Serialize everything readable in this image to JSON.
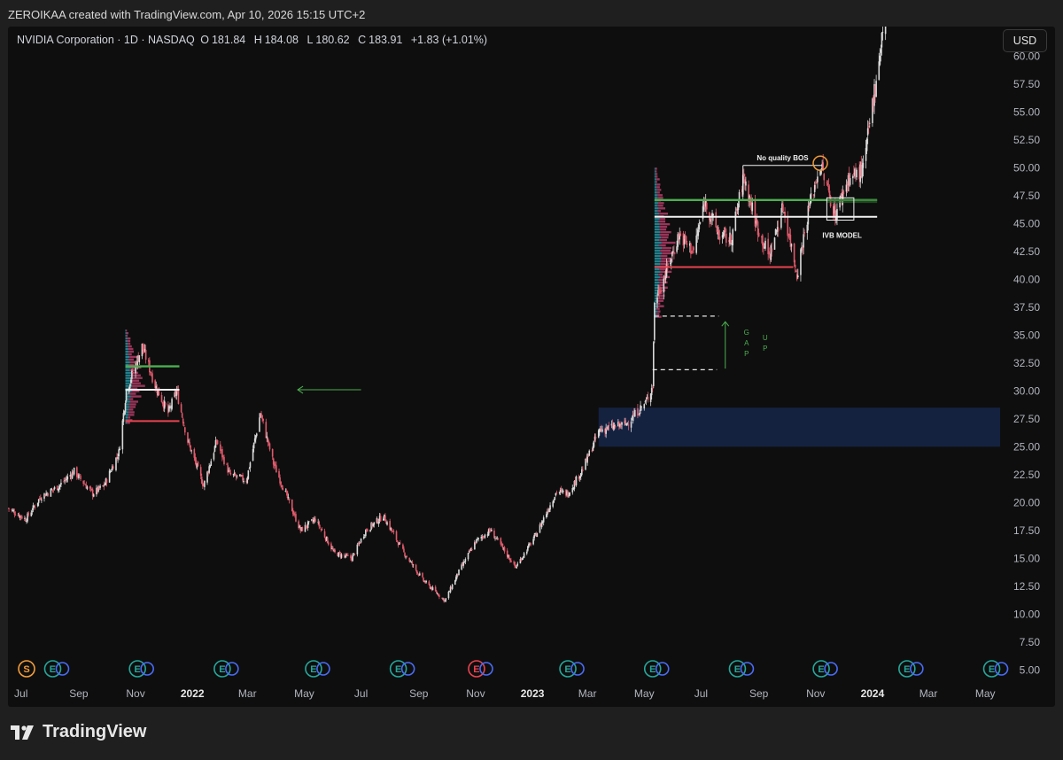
{
  "attribution": "ZEROIKAA created with TradingView.com, Apr 10, 2026 15:15 UTC+2",
  "header": {
    "symbol": "NVIDIA Corporation · 1D · NASDAQ",
    "open_label": "O",
    "open": "181.84",
    "high_label": "H",
    "high": "184.08",
    "low_label": "L",
    "low": "180.62",
    "close_label": "C",
    "close": "183.91",
    "change": "+1.83 (+1.01%)"
  },
  "currency_button": "USD",
  "footer": {
    "brand": "TradingView"
  },
  "colors": {
    "up": "#d9d9d9",
    "down": "#e0596b",
    "green_level": "#4caf50",
    "red_level": "#e8434f",
    "fvg_zone": "#142240",
    "arrow": "#4caf50",
    "highlight_circle": "#f39c3a",
    "volume_profile_up": "#2aa7b8",
    "volume_profile_down": "#d6467a"
  },
  "chart_data": {
    "type": "candlestick",
    "instrument": "NVDA",
    "timeframe": "1D",
    "y_axis": {
      "ylim": [
        3.0,
        63.0
      ],
      "ticks": [
        5.0,
        7.5,
        10.0,
        12.5,
        15.0,
        17.5,
        20.0,
        22.5,
        25.0,
        27.5,
        30.0,
        32.5,
        35.0,
        37.5,
        40.0,
        42.5,
        45.0,
        47.5,
        50.0,
        52.5,
        55.0,
        57.5,
        60.0
      ]
    },
    "x_axis": {
      "range": [
        "2021-07-01",
        "2024-05-31"
      ],
      "ticks": [
        {
          "label": "Jul",
          "date": "2021-07-15"
        },
        {
          "label": "Sep",
          "date": "2021-09-15"
        },
        {
          "label": "Nov",
          "date": "2021-11-15"
        },
        {
          "label": "2022",
          "date": "2022-01-15",
          "bold": true
        },
        {
          "label": "Mar",
          "date": "2022-03-15"
        },
        {
          "label": "May",
          "date": "2022-05-15"
        },
        {
          "label": "Jul",
          "date": "2022-07-15"
        },
        {
          "label": "Sep",
          "date": "2022-09-15"
        },
        {
          "label": "Nov",
          "date": "2022-11-15"
        },
        {
          "label": "2023",
          "date": "2023-01-15",
          "bold": true
        },
        {
          "label": "Mar",
          "date": "2023-03-15"
        },
        {
          "label": "May",
          "date": "2023-05-15"
        },
        {
          "label": "Jul",
          "date": "2023-07-15"
        },
        {
          "label": "Sep",
          "date": "2023-09-15"
        },
        {
          "label": "Nov",
          "date": "2023-11-15"
        },
        {
          "label": "2024",
          "date": "2024-01-15",
          "bold": true
        },
        {
          "label": "Mar",
          "date": "2024-03-15"
        },
        {
          "label": "May",
          "date": "2024-05-15"
        }
      ]
    },
    "price_path": [
      [
        "2021-07-01",
        19.5
      ],
      [
        "2021-07-20",
        18.5
      ],
      [
        "2021-08-05",
        20.5
      ],
      [
        "2021-08-25",
        21.5
      ],
      [
        "2021-09-10",
        22.8
      ],
      [
        "2021-09-30",
        20.8
      ],
      [
        "2021-10-12",
        21.5
      ],
      [
        "2021-10-28",
        24.5
      ],
      [
        "2021-11-05",
        30.0
      ],
      [
        "2021-11-22",
        34.0
      ],
      [
        "2021-12-06",
        30.5
      ],
      [
        "2021-12-20",
        28.0
      ],
      [
        "2021-12-29",
        30.0
      ],
      [
        "2022-01-10",
        25.5
      ],
      [
        "2022-01-27",
        21.5
      ],
      [
        "2022-02-10",
        25.5
      ],
      [
        "2022-02-24",
        22.5
      ],
      [
        "2022-03-14",
        22.0
      ],
      [
        "2022-03-29",
        28.0
      ],
      [
        "2022-04-12",
        23.5
      ],
      [
        "2022-05-11",
        17.5
      ],
      [
        "2022-05-27",
        18.5
      ],
      [
        "2022-06-16",
        15.5
      ],
      [
        "2022-07-05",
        15.0
      ],
      [
        "2022-07-20",
        17.5
      ],
      [
        "2022-08-08",
        18.8
      ],
      [
        "2022-08-30",
        15.5
      ],
      [
        "2022-09-20",
        13.0
      ],
      [
        "2022-10-13",
        11.2
      ],
      [
        "2022-10-28",
        13.8
      ],
      [
        "2022-11-15",
        16.5
      ],
      [
        "2022-12-01",
        17.5
      ],
      [
        "2022-12-28",
        14.2
      ],
      [
        "2023-01-18",
        17.0
      ],
      [
        "2023-02-10",
        21.0
      ],
      [
        "2023-02-22",
        20.8
      ],
      [
        "2023-03-10",
        23.0
      ],
      [
        "2023-03-28",
        26.5
      ],
      [
        "2023-04-25",
        27.0
      ],
      [
        "2023-05-17",
        29.0
      ],
      [
        "2023-05-24",
        30.5
      ],
      [
        "2023-05-26",
        38.0
      ],
      [
        "2023-06-07",
        40.5
      ],
      [
        "2023-06-21",
        44.0
      ],
      [
        "2023-07-07",
        42.5
      ],
      [
        "2023-07-19",
        47.0
      ],
      [
        "2023-08-03",
        44.0
      ],
      [
        "2023-08-16",
        43.5
      ],
      [
        "2023-08-30",
        49.2
      ],
      [
        "2023-09-12",
        45.0
      ],
      [
        "2023-09-26",
        42.0
      ],
      [
        "2023-10-11",
        46.5
      ],
      [
        "2023-10-26",
        40.5
      ],
      [
        "2023-11-08",
        46.5
      ],
      [
        "2023-11-20",
        50.3
      ],
      [
        "2023-12-06",
        45.8
      ],
      [
        "2023-12-20",
        49.0
      ],
      [
        "2024-01-05",
        49.8
      ],
      [
        "2024-01-24",
        61.0
      ],
      [
        "2024-02-05",
        70.0
      ]
    ],
    "volume_profiles": [
      {
        "date": "2021-11-04",
        "price_low": 27.0,
        "price_high": 35.5,
        "width_days": 28
      },
      {
        "date": "2023-05-26",
        "price_low": 36.5,
        "price_high": 50.0,
        "width_days": 30
      }
    ],
    "levels": [
      {
        "name": "green-level-1",
        "price": 32.2,
        "start": "2021-11-04",
        "end": "2022-01-01",
        "color": "green"
      },
      {
        "name": "white-level-1",
        "price": 30.1,
        "start": "2021-11-04",
        "end": "2022-01-01",
        "color": "white"
      },
      {
        "name": "red-level-1",
        "price": 27.3,
        "start": "2021-11-04",
        "end": "2022-01-01",
        "color": "red"
      },
      {
        "name": "green-level-2",
        "price": 47.1,
        "start": "2023-05-26",
        "end": "2024-01-20",
        "color": "green"
      },
      {
        "name": "white-level-2",
        "price": 45.6,
        "start": "2023-05-26",
        "end": "2024-01-20",
        "color": "white"
      },
      {
        "name": "red-level-2",
        "price": 41.1,
        "start": "2023-05-26",
        "end": "2023-10-22",
        "color": "red"
      }
    ],
    "gap_lines": [
      {
        "price": 36.7,
        "start": "2023-05-26",
        "end": "2023-08-03"
      },
      {
        "price": 31.9,
        "start": "2023-05-24",
        "end": "2023-08-01"
      }
    ],
    "fvg_zone": {
      "start": "2023-03-27",
      "end": "2024-06-01",
      "price_low": 25.0,
      "price_high": 28.5
    },
    "annotations": {
      "bos_label": "No quality BOS",
      "bos_line": {
        "price": 50.2,
        "start": "2023-08-29",
        "end": "2023-11-22"
      },
      "bos_circle": {
        "date": "2023-11-20",
        "price": 50.4
      },
      "ivb_label": "IVB MODEL",
      "ivb_box": {
        "start": "2023-11-27",
        "end": "2023-12-26",
        "price_low": 45.3,
        "price_high": 47.3
      },
      "gap_letters_1": [
        "G",
        "A",
        "P"
      ],
      "gap_letters_2": [
        "U",
        "P"
      ],
      "gap_arrow": {
        "date": "2023-08-10",
        "from": 32.0,
        "to": 36.2
      },
      "left_arrow": {
        "price": 30.1,
        "from_date": "2022-07-15",
        "to_date": "2022-05-08"
      }
    },
    "events": [
      {
        "type": "S",
        "date": "2021-07-21",
        "color": "#f39c3a"
      },
      {
        "type": "E",
        "date": "2021-08-18",
        "color": "#26a69a"
      },
      {
        "type": "E",
        "date": "2021-11-17",
        "color": "#26a69a"
      },
      {
        "type": "E",
        "date": "2022-02-16",
        "color": "#26a69a"
      },
      {
        "type": "E",
        "date": "2022-05-25",
        "color": "#26a69a"
      },
      {
        "type": "E",
        "date": "2022-08-24",
        "color": "#26a69a"
      },
      {
        "type": "E",
        "date": "2022-11-16",
        "color": "#e8434f"
      },
      {
        "type": "E",
        "date": "2023-02-22",
        "color": "#26a69a"
      },
      {
        "type": "E",
        "date": "2023-05-24",
        "color": "#26a69a"
      },
      {
        "type": "E",
        "date": "2023-08-23",
        "color": "#26a69a"
      },
      {
        "type": "E",
        "date": "2023-11-21",
        "color": "#26a69a"
      },
      {
        "type": "E",
        "date": "2024-02-21",
        "color": "#26a69a"
      },
      {
        "type": "E",
        "date": "2024-05-22",
        "color": "#26a69a"
      }
    ]
  }
}
